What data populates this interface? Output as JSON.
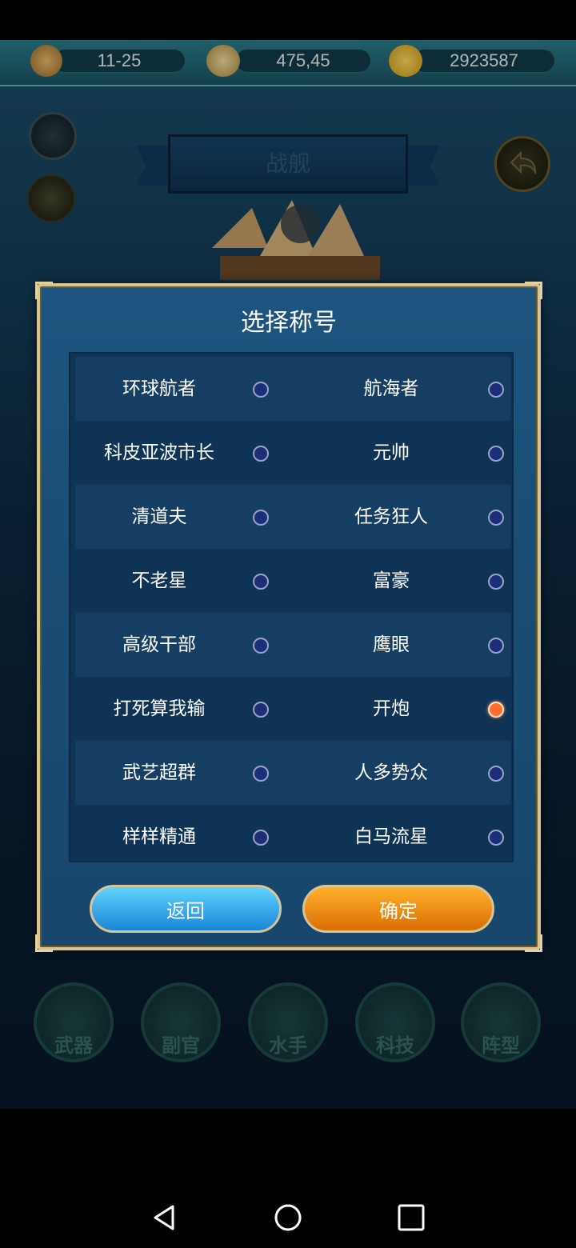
{
  "resources": {
    "date": "11-25",
    "coords": "475,45",
    "gold": "2923587"
  },
  "page_title": "战舰",
  "dialog": {
    "title": "选择称号",
    "titles": [
      {
        "left": "环球航者",
        "right": "航海者"
      },
      {
        "left": "科皮亚波市长",
        "right": "元帅"
      },
      {
        "left": "清道夫",
        "right": "任务狂人"
      },
      {
        "left": "不老星",
        "right": "富豪"
      },
      {
        "left": "高级干部",
        "right": "鹰眼"
      },
      {
        "left": "打死算我输",
        "right": "开炮"
      },
      {
        "left": "武艺超群",
        "right": "人多势众"
      },
      {
        "left": "样样精通",
        "right": "白马流星"
      }
    ],
    "selected": "开炮",
    "back_label": "返回",
    "confirm_label": "确定"
  },
  "bottom_menu": [
    "武器",
    "副官",
    "水手",
    "科技",
    "阵型"
  ],
  "colors": {
    "accent_gold": "#d8c491",
    "selected_radio": "#ff6d2a",
    "confirm_button": "#f08a12",
    "back_button": "#2fa8ec"
  }
}
